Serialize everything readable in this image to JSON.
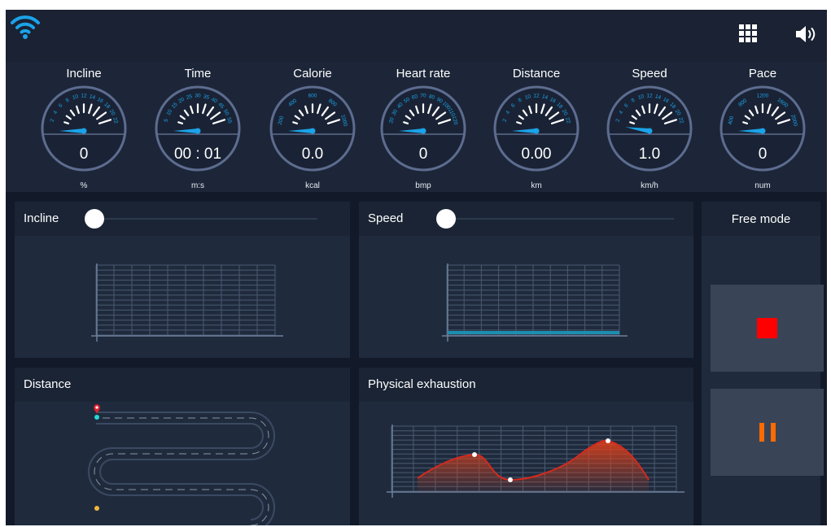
{
  "colors": {
    "accent": "#1aa3e8",
    "gauge_ring": "#5d6c8f",
    "stop": "#ff0000",
    "pause": "#ff6a00",
    "curve": "#d42a1e",
    "speed_bar": "#1c8fb0"
  },
  "topbar": {
    "wifi_icon": "wifi-icon",
    "grid_icon": "grid-menu-icon",
    "volume_icon": "volume-icon"
  },
  "gauges": [
    {
      "title": "Incline",
      "value": "0",
      "unit": "%",
      "scale": [
        "2",
        "4",
        "6",
        "8",
        "10",
        "12",
        "14",
        "16",
        "18",
        "20",
        "22"
      ],
      "needle_fraction": 0.0
    },
    {
      "title": "Time",
      "value": "00 : 01",
      "unit": "m:s",
      "scale": [
        "5",
        "10",
        "15",
        "20",
        "25",
        "30",
        "35",
        "40",
        "45",
        "50",
        "55"
      ],
      "needle_fraction": 0.0
    },
    {
      "title": "Calorie",
      "value": "0.0",
      "unit": "kcal",
      "scale": [
        "200",
        "400",
        "600",
        "800",
        "1000"
      ],
      "needle_fraction": 0.0
    },
    {
      "title": "Heart rate",
      "value": "0",
      "unit": "bmp",
      "scale": [
        "20",
        "30",
        "40",
        "50",
        "60",
        "70",
        "80",
        "90",
        "100",
        "110",
        "120"
      ],
      "needle_fraction": 0.0
    },
    {
      "title": "Distance",
      "value": "0.00",
      "unit": "km",
      "scale": [
        "2",
        "4",
        "6",
        "8",
        "10",
        "12",
        "14",
        "16",
        "18",
        "20",
        "22"
      ],
      "needle_fraction": 0.0
    },
    {
      "title": "Speed",
      "value": "1.0",
      "unit": "km/h",
      "scale": [
        "2",
        "4",
        "6",
        "8",
        "10",
        "12",
        "14",
        "16",
        "18",
        "20",
        "22"
      ],
      "needle_fraction": 0.05
    },
    {
      "title": "Pace",
      "value": "0",
      "unit": "num",
      "scale": [
        "400",
        "800",
        "1200",
        "1600",
        "2000"
      ],
      "needle_fraction": 0.0
    }
  ],
  "panels": {
    "incline": {
      "title": "Incline",
      "slider_fraction": 0.0
    },
    "speed": {
      "title": "Speed",
      "slider_fraction": 0.0
    },
    "distance": {
      "title": "Distance"
    },
    "exhaustion": {
      "title": "Physical exhaustion"
    }
  },
  "mode": {
    "title": "Free mode",
    "stop_icon": "stop-icon",
    "pause_icon": "pause-icon"
  }
}
